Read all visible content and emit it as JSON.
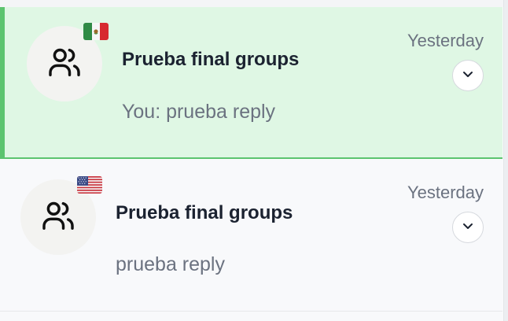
{
  "conversations": [
    {
      "state": "selected",
      "flag": "mexico-flag",
      "avatar_icon": "users-icon",
      "title": "Prueba final groups",
      "preview": "You: prueba reply",
      "time": "Yesterday",
      "menu_icon": "chevron-down-icon"
    },
    {
      "state": "default",
      "flag": "us-flag",
      "avatar_icon": "users-icon",
      "title": "Prueba final groups",
      "preview": "prueba reply",
      "time": "Yesterday",
      "menu_icon": "chevron-down-icon"
    }
  ],
  "colors": {
    "selected_background": "#dff7e4",
    "selected_accent": "#5cc46f",
    "default_background": "#f8f9fb",
    "title_text": "#1b2230",
    "secondary_text": "#6b7280"
  }
}
